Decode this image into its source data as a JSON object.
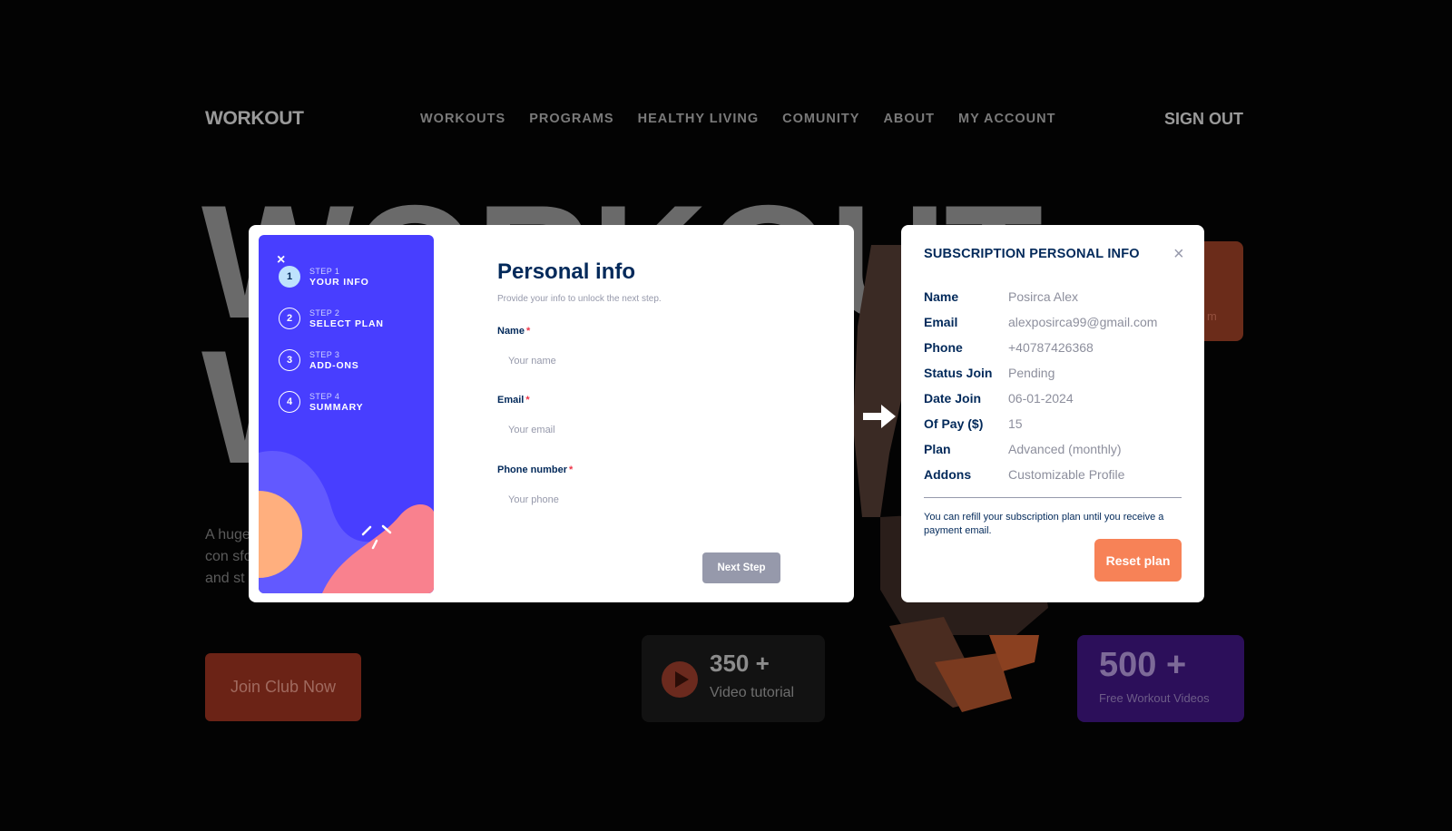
{
  "background": {
    "logo": "WORKOUT",
    "nav_items": [
      "WORKOUTS",
      "PROGRAMS",
      "HEALTHY LIVING",
      "COMUNITY",
      "ABOUT",
      "MY ACCOUNT"
    ],
    "sign_out": "SIGN OUT",
    "hero_line1": "WORKOUT",
    "hero_line2": "W",
    "description": "A huge ss con sforma and st",
    "join_button": "Join Club Now",
    "video_count": "350 +",
    "video_label": "Video tutorial",
    "free_count": "500 +",
    "free_label": "Free Workout Videos",
    "card_fragment": "m"
  },
  "form_modal": {
    "close_icon": "×",
    "steps": [
      {
        "num": "1",
        "step": "STEP 1",
        "title": "YOUR INFO",
        "active": true
      },
      {
        "num": "2",
        "step": "STEP 2",
        "title": "SELECT PLAN",
        "active": false
      },
      {
        "num": "3",
        "step": "STEP 3",
        "title": "ADD-ONS",
        "active": false
      },
      {
        "num": "4",
        "step": "STEP 4",
        "title": "SUMMARY",
        "active": false
      }
    ],
    "title": "Personal info",
    "subtitle": "Provide your info to unlock the next step.",
    "fields": {
      "name": {
        "label": "Name",
        "required": "*",
        "placeholder": "Your name"
      },
      "email": {
        "label": "Email",
        "required": "*",
        "placeholder": "Your email"
      },
      "phone": {
        "label": "Phone number",
        "required": "*",
        "placeholder": "Your phone"
      }
    },
    "next_button": "Next Step"
  },
  "subscription_modal": {
    "title": "SUBSCRIPTION PERSONAL INFO",
    "close_icon": "×",
    "rows": [
      {
        "key": "Name",
        "value": "Posirca Alex"
      },
      {
        "key": "Email",
        "value": "alexposirca99@gmail.com"
      },
      {
        "key": "Phone",
        "value": "+40787426368"
      },
      {
        "key": "Status Join",
        "value": "Pending"
      },
      {
        "key": "Date Join",
        "value": "06-01-2024"
      },
      {
        "key": "Of Pay ($)",
        "value": "15"
      },
      {
        "key": "Plan",
        "value": "Advanced (monthly)"
      },
      {
        "key": "Addons",
        "value": "Customizable Profile"
      }
    ],
    "note": "You can refill your subscription plan until you receive a payment email.",
    "reset_button": "Reset plan"
  },
  "colors": {
    "sidebar": "#483eff",
    "marine_blue": "#02295a",
    "cool_gray": "#9699ab",
    "accent_orange": "#f78257",
    "step_active": "#bee2fd"
  }
}
